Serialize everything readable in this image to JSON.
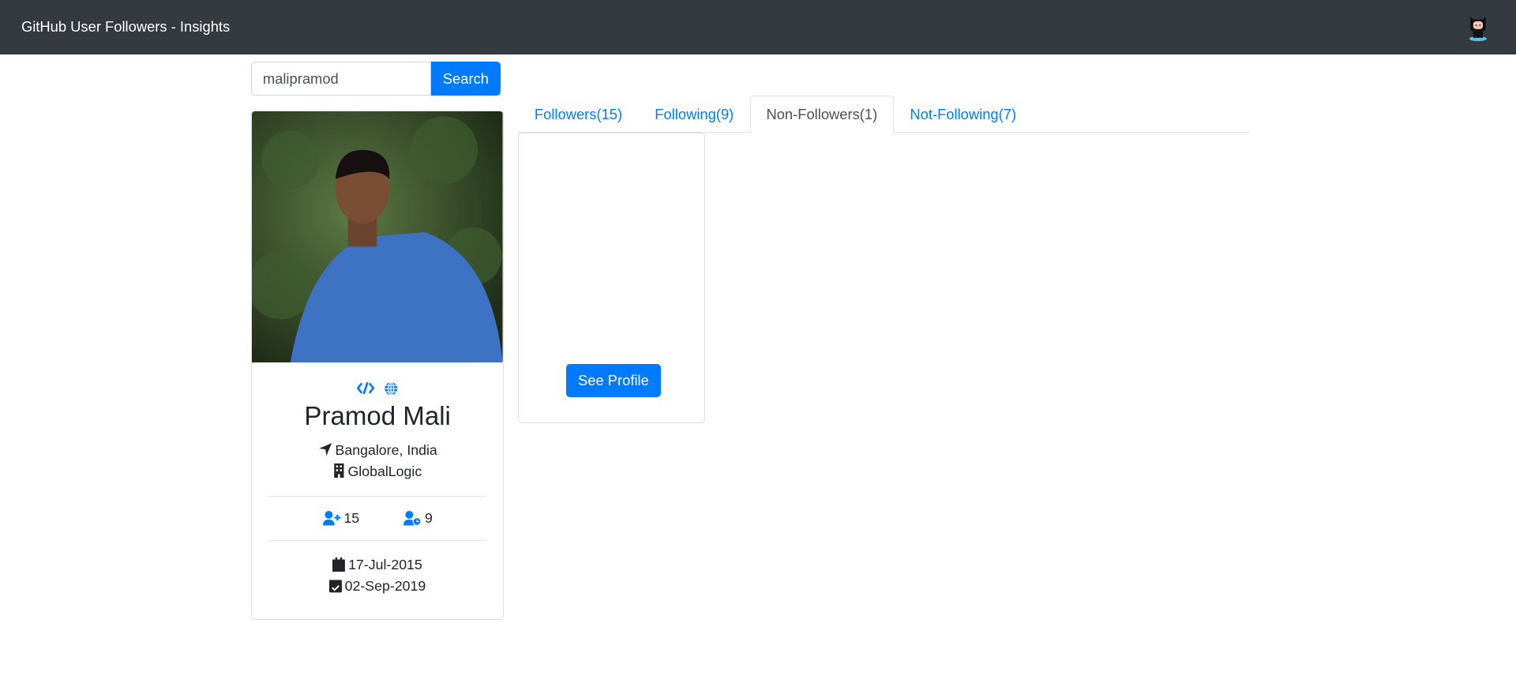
{
  "navbar": {
    "title": "GitHub User Followers - Insights",
    "avatar_icon": "octocat-icon"
  },
  "search": {
    "value": "malipramod",
    "button_label": "Search"
  },
  "profile": {
    "name": "Pramod Mali",
    "links": [
      "code-icon",
      "globe-icon"
    ],
    "location": "Bangalore, India",
    "company": "GlobalLogic",
    "followers": "15",
    "following": "9",
    "created": "17-Jul-2015",
    "updated": "02-Sep-2019"
  },
  "tabs": [
    {
      "label": "Followers(15)",
      "active": false
    },
    {
      "label": "Following(9)",
      "active": false
    },
    {
      "label": "Non-Followers(1)",
      "active": true
    },
    {
      "label": "Not-Following(7)",
      "active": false
    }
  ],
  "result_card": {
    "button_label": "See Profile"
  },
  "colors": {
    "primary": "#007bff",
    "navbar": "#343a40"
  }
}
